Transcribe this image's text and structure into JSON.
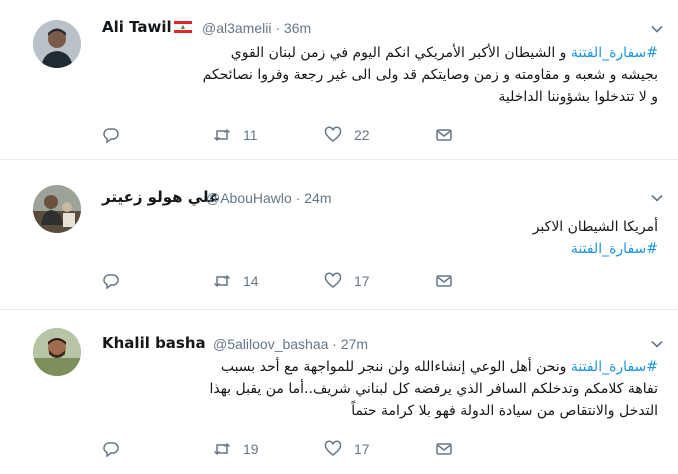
{
  "tweets": [
    {
      "name": "Ali Tawil",
      "handle": "@al3amelii",
      "time": "36m",
      "line1_tag": "#سفارة_الفتنة",
      "line1_text": " و الشيطان الأكبر الأمريكي انكم اليوم في زمن لبنان القوي",
      "line2": "بجيشه و شعبه و مقاومته و زمن وصايتكم قد ولى الى غير رجعة وفروا نصائحكم",
      "line3": "و لا تتدخلوا بشؤوننا الداخلية",
      "replies": "",
      "retweets": "11",
      "likes": "22"
    },
    {
      "name": "علي هولو زعيتر",
      "handle": "@AbouHawlo",
      "time": "24m",
      "line1": "أمريكا الشيطان الاكبر",
      "line2_tag": "#سفارة_الفتنة",
      "replies": "",
      "retweets": "14",
      "likes": "17"
    },
    {
      "name": "Khalil basha",
      "handle": "@5aliloov_bashaa",
      "time": "27m",
      "line1_tag": "#سفارة_الفتنة",
      "line1_text": " ونحن أهل الوعي إنشاءالله ولن ننجر للمواجهة مع أحد بسبب",
      "line2": "تفاهة كلامكم وتدخلكم السافر الذي يرفضه كل لبناني شريف..أما من يقبل بهذا",
      "line3": "التدخل والانتقاص من سيادة الدولة فهو بلا كرامة حتماً",
      "replies": "",
      "retweets": "19",
      "likes": "17"
    }
  ],
  "colors": {
    "hashtag": "#1b95e0",
    "muted": "#657786",
    "divider": "#e6ecf0"
  }
}
